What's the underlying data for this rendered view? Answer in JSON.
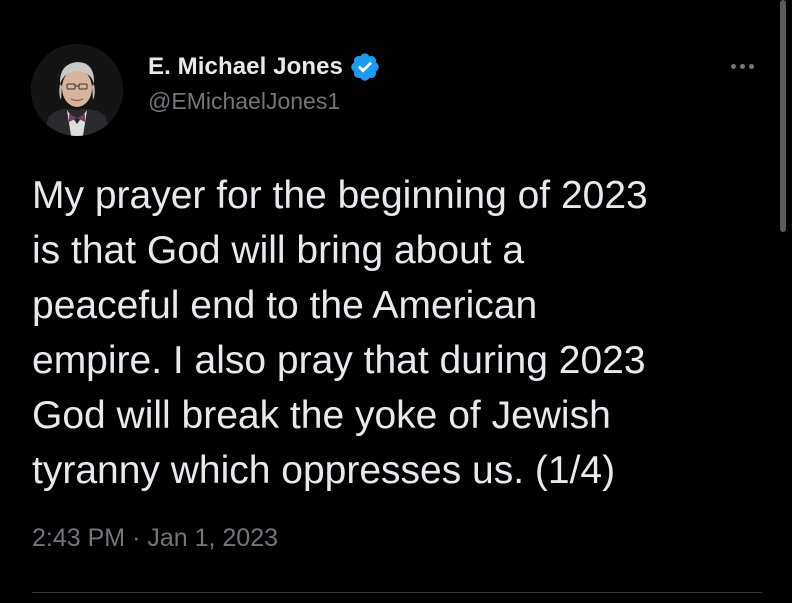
{
  "author": {
    "display_name": "E. Michael Jones",
    "handle": "@EMichaelJones1",
    "verified": true,
    "avatar_icon": "profile-photo-avatar"
  },
  "tweet": {
    "lines": [
      "My prayer for the beginning of 2023",
      "is that God will bring about a",
      "peaceful end to the American",
      "empire. I also pray that during 2023",
      "God will break the yoke of Jewish",
      "tyranny which oppresses us. (1/4)"
    ],
    "time": "2:43 PM",
    "separator": "·",
    "date": "Jan 1, 2023"
  },
  "icons": {
    "verified": "verified-badge-icon",
    "more": "more-options-icon"
  },
  "colors": {
    "background": "#000000",
    "primary_text": "#e7e9ea",
    "secondary_text": "#71767b",
    "verified_blue": "#1d9bf0"
  }
}
